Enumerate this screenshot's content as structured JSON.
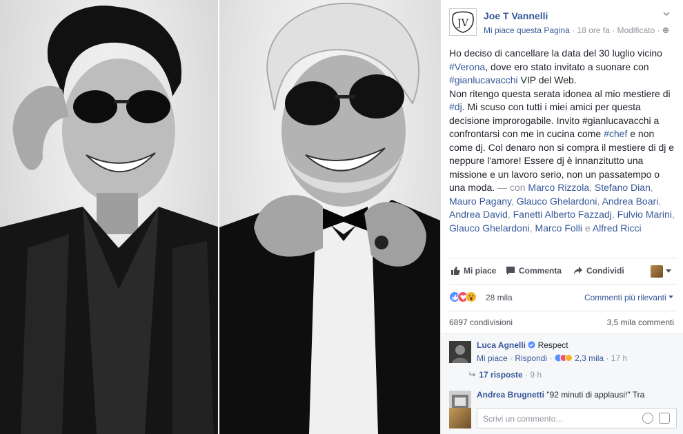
{
  "page": {
    "name": "Joe T Vannelli",
    "like_page": "Mi piace questa Pagina",
    "meta_rest": " · 18 ore fa · Modificato · "
  },
  "post": {
    "p1": "Ho deciso di cancellare la data del 30 luglio vicino ",
    "tag_verona": "#Verona",
    "p2": ", dove ero stato invitato a suonare con ",
    "tag_gianluca1": "#gianlucavacchi",
    "p3": " VIP del Web.",
    "p4": "Non ritengo questa serata idonea al mio mestiere di ",
    "tag_dj": "#dj",
    "p5": ". Mi scuso con tutti i miei amici per questa decisione improrogabile. Invito #gianlucavacchi a confrontarsi con me in cucina come ",
    "tag_chef": "#chef",
    "p6": " e non come dj. Col denaro non si compra il mestiere di dj e neppure l'amore! Essere dj è innanzitutto una missione e un lavoro serio, non un passatempo o una moda.",
    "with_prefix": " — con ",
    "with_names": [
      "Marco Rizzola",
      "Stefano Dian",
      "Mauro Pagany",
      "Glauco Ghelardoni",
      "Andrea Boari",
      "Andrea David",
      "Fanetti Alberto Fazzadj",
      "Fulvio Marini",
      "Glauco Ghelardoni",
      "Marco Folli"
    ],
    "with_and": " e ",
    "with_last": "Alfred Ricci"
  },
  "actions": {
    "like": "Mi piace",
    "comment": "Commenta",
    "share": "Condividi"
  },
  "reactions": {
    "count": "28 mila",
    "sort": "Commenti più rilevanti"
  },
  "stats": {
    "shares": "6897 condivisioni",
    "comments": "3,5 mila commenti"
  },
  "comments": [
    {
      "author": "Luca Agnelli",
      "text": "Respect",
      "like": "Mi piace",
      "reply": "Rispondi",
      "reactions": "2,3 mila",
      "time": "17 h",
      "replies": "17 risposte",
      "replies_time": "9 h"
    },
    {
      "author": "Andrea Brugnetti",
      "text": "\"92 minuti di applausi!\" Tra"
    }
  ],
  "composer": {
    "placeholder": "Scrivi un commento..."
  },
  "colors": {
    "link": "#365899",
    "text": "#1d2129",
    "muted": "#90949c",
    "like_blue": "#5890ff",
    "love_red": "#f25268",
    "wow_yellow": "#f7b125"
  }
}
